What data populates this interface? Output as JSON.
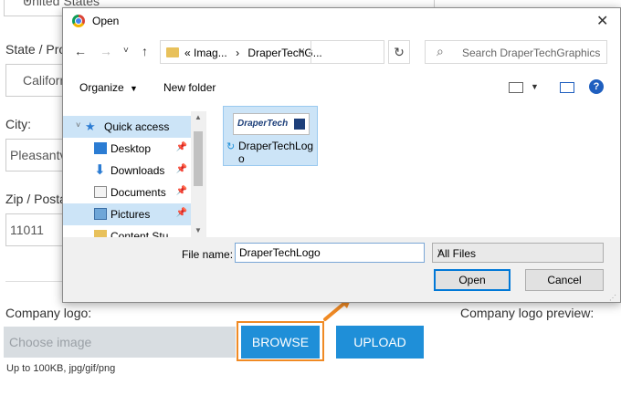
{
  "form": {
    "country_value": "United States",
    "state_label": "State / Pro",
    "state_value": "Californ",
    "city_label": "City:",
    "city_value": "Pleasantv",
    "zip_label": "Zip / Posta",
    "zip_value": "11011",
    "logo_label": "Company logo:",
    "choose_placeholder": "Choose image",
    "browse_label": "BROWSE",
    "upload_label": "UPLOAD",
    "hint": "Up to 100KB, jpg/gif/png",
    "preview_label": "Company logo preview:"
  },
  "dialog": {
    "title": "Open",
    "address": {
      "prefix": "«",
      "segments": [
        "Imag...",
        "DraperTechG..."
      ]
    },
    "search_placeholder": "Search DraperTechGraphics",
    "toolbar": {
      "organize": "Organize",
      "new_folder": "New folder"
    },
    "nav_items": [
      {
        "label": "Quick access",
        "icon": "star-icon"
      },
      {
        "label": "Desktop",
        "icon": "desktop-icon"
      },
      {
        "label": "Downloads",
        "icon": "download-arrow-icon"
      },
      {
        "label": "Documents",
        "icon": "documents-icon"
      },
      {
        "label": "Pictures",
        "icon": "pictures-icon"
      },
      {
        "label": "Content Stu...",
        "icon": "folder-icon"
      }
    ],
    "file": {
      "name": "DraperTechLogo",
      "thumbnail_text": "DraperTech"
    },
    "file_name_label": "File name:",
    "file_name_value": "DraperTechLogo",
    "filter_value": "All Files",
    "open_label": "Open",
    "cancel_label": "Cancel"
  },
  "colors": {
    "accent_blue": "#1f8fd8",
    "highlight_orange": "#f08a24",
    "selection": "#cce4f7"
  }
}
